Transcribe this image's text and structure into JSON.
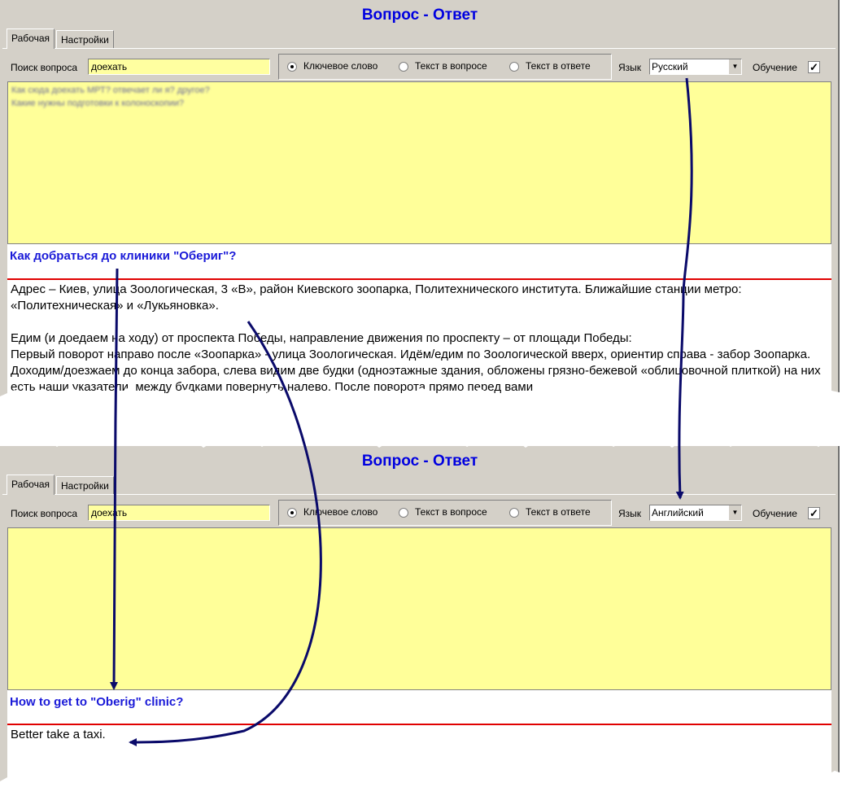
{
  "screens": [
    {
      "title": "Вопрос - Ответ",
      "tabs": [
        "Рабочая",
        "Настройки"
      ],
      "search_label": "Поиск вопроса",
      "search_value": "доехать",
      "radio_options": [
        "Ключевое слово",
        "Текст в вопросе",
        "Текст в ответе"
      ],
      "radio_selected": 0,
      "language_label": "Язык",
      "language_value": "Русский",
      "learning_label": "Обучение",
      "learning_checked": true,
      "blurred_results": [
        "Как сюда доехать МРТ? отвечает ли я? другое?",
        "Какие нужны подготовки к колоноскопии?"
      ],
      "question": "Как добраться до клиники \"Обериг\"?",
      "answer_paragraphs": [
        "Адрес – Киев, улица Зоологическая, 3 «В», район Киевского зоопарка, Политехнического института. Ближайшие станции метро: «Политехническая» и «Лукьяновка».",
        "Едим (и доедаем на ходу) от проспекта Победы, направление движения по проспекту – от площади Победы:\nПервый поворот направо после «Зоопарка» - улица Зоологическая. Идём/едим по Зоологической вверх, ориентир справа - забор Зоопарка. Доходим/доезжаем до конца забора, слева видим две будки (одноэтажные здания, обложены грязно-бежевой «облицовочной плиткой) на них есть наши указатели, между будками повернуть налево. После поворота прямо перед вами"
      ]
    },
    {
      "title": "Вопрос - Ответ",
      "tabs": [
        "Рабочая",
        "Настройки"
      ],
      "search_label": "Поиск вопроса",
      "search_value": "доехать",
      "radio_options": [
        "Ключевое слово",
        "Текст в вопросе",
        "Текст в ответе"
      ],
      "radio_selected": 0,
      "language_label": "Язык",
      "language_value": "Английский",
      "learning_label": "Обучение",
      "learning_checked": true,
      "question": "How to get to \"Oberig\" clinic?",
      "answer_paragraphs": [
        "Better take a taxi."
      ]
    }
  ],
  "colors": {
    "window_bg": "#d4d0c8",
    "title_blue": "#0000e0",
    "question_blue": "#1a1ad8",
    "results_yellow": "#ffff99",
    "input_yellow": "#ffffa0",
    "divider_red": "#e00000",
    "arrow_navy": "#0a0a6a"
  },
  "icons": {
    "dropdown": "chevron-down-icon",
    "checkbox": "checkmark-icon"
  }
}
